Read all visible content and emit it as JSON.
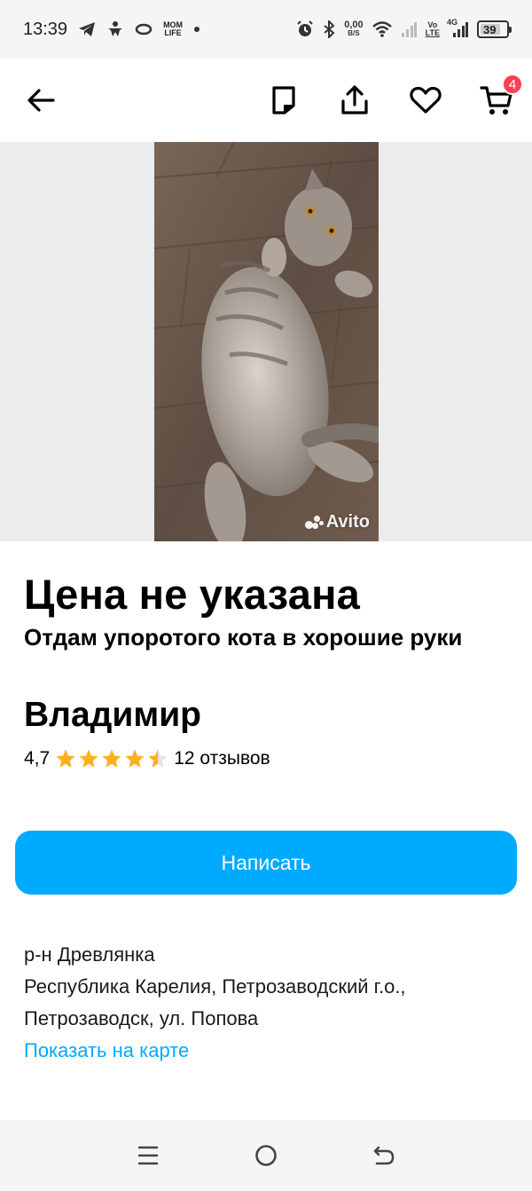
{
  "status_bar": {
    "time": "13:39",
    "speed_value": "0,00",
    "speed_unit": "B/S",
    "volte_top": "Vo",
    "volte_bottom": "LTE",
    "network": "4G",
    "battery": "39",
    "app_badge_top": "MOM",
    "app_badge_bottom": "LIFE"
  },
  "top_bar": {
    "cart_count": "4",
    "icons": [
      "back-arrow-icon",
      "note-icon",
      "share-icon",
      "heart-icon",
      "cart-icon"
    ]
  },
  "gallery": {
    "watermark": "Avito"
  },
  "listing": {
    "price": "Цена не указана",
    "title": "Отдам упоротого кота в хорошие руки"
  },
  "seller": {
    "name": "Владимир",
    "rating": "4,7",
    "rating_value": 4.7,
    "reviews": "12 отзывов"
  },
  "actions": {
    "write_label": "Написать"
  },
  "location": {
    "district": "р-н Древлянка",
    "line1": "Республика Карелия, Петрозаводский г.о.,",
    "line2": "Петрозаводск, ул. Попова",
    "map_link": "Показать на карте"
  },
  "colors": {
    "accent": "#00aaff",
    "badge": "#ff4053",
    "star": "#ffb021"
  }
}
